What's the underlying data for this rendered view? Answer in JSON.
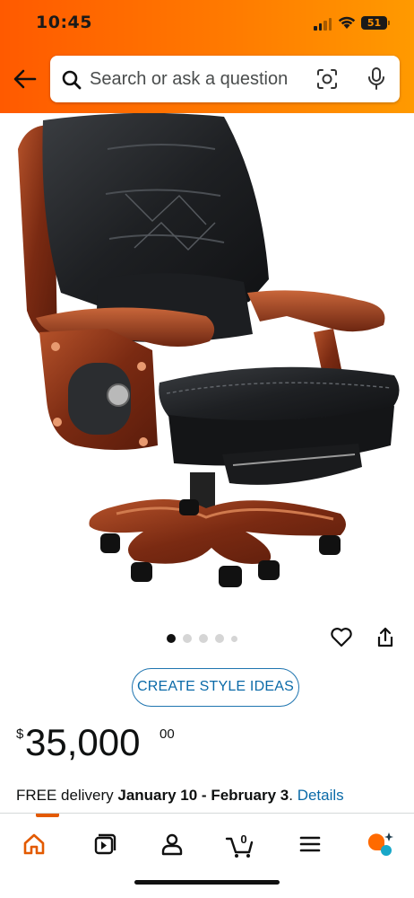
{
  "status_bar": {
    "time": "10:45",
    "battery": "51"
  },
  "search": {
    "placeholder": "Search or ask a question"
  },
  "gallery": {
    "image_description_icon": "chair-photo",
    "image_count": 5,
    "active_index": 0
  },
  "actions": {
    "create_style_label": "CREATE STYLE IDEAS"
  },
  "price": {
    "symbol": "$",
    "whole": "35,000",
    "fraction": "00"
  },
  "delivery": {
    "prefix": "FREE delivery",
    "dates": "January 10 - February 3",
    "suffix": ".",
    "details_link": "Details"
  },
  "bottom_nav": {
    "items": [
      "home-icon",
      "video-icon",
      "account-icon",
      "cart-icon",
      "menu-icon",
      "rufus-icon"
    ],
    "cart_count": "0"
  },
  "colors": {
    "header": "#ff6f00",
    "link": "#0a6aa8",
    "active_nav": "#e35a00"
  }
}
